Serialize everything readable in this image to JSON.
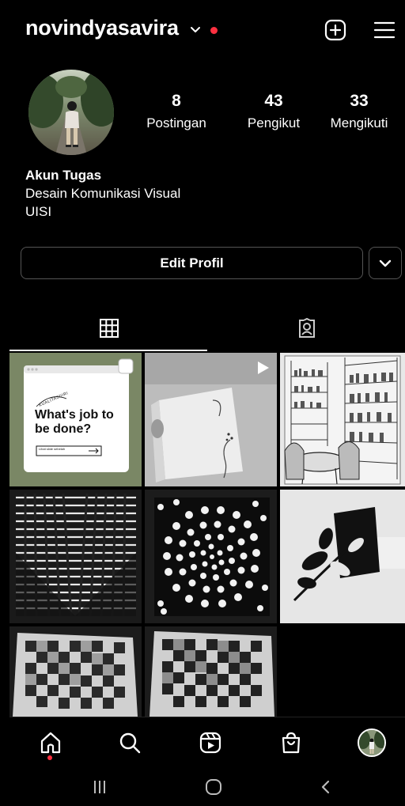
{
  "header": {
    "username": "novindyasavira",
    "icons": [
      "chevron-down-icon",
      "new-post-icon",
      "menu-icon"
    ]
  },
  "profile": {
    "stats": [
      {
        "count": "8",
        "label": "Postingan"
      },
      {
        "count": "43",
        "label": "Pengikut"
      },
      {
        "count": "33",
        "label": "Mengikuti"
      }
    ],
    "bio": {
      "name": "Akun Tugas",
      "line1": "Desain Komunikasi Visual",
      "line2": "UISI"
    },
    "edit_label": "Edit Profil"
  },
  "tabs": [
    "grid-icon",
    "tagged-icon"
  ],
  "posts": {
    "post1": {
      "heading": "What's job to be done?",
      "curved_text": "KUALITASDIRI",
      "input_text": "Lihat slide sebelah"
    }
  },
  "bottom_nav": [
    "home-icon",
    "search-icon",
    "reels-icon",
    "shop-icon",
    "profile-avatar"
  ],
  "colors": {
    "background": "#000000",
    "text": "#ffffff",
    "notification": "#ff3040",
    "border": "#555555"
  }
}
